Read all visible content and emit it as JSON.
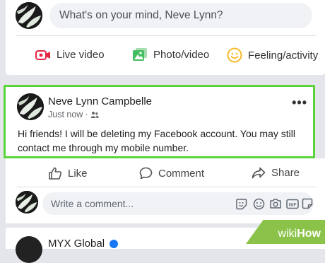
{
  "composer": {
    "placeholder": "What's on your mind, Neve Lynn?",
    "actions": [
      {
        "label": "Live video",
        "icon": "live-video-icon",
        "color": "#e42645"
      },
      {
        "label": "Photo/video",
        "icon": "photo-icon",
        "color": "#45bd62"
      },
      {
        "label": "Feeling/activity",
        "icon": "feeling-icon",
        "color": "#f7b928"
      }
    ]
  },
  "post": {
    "author": "Neve Lynn Campbelle",
    "time": "Just now",
    "separator": "·",
    "audience_icon": "friends-icon",
    "text": "Hi friends! I will be deleting my Facebook account. You may still contact me through my mobile number.",
    "highlight_color": "#5ad43a"
  },
  "reactions": {
    "like": "Like",
    "comment": "Comment",
    "share": "Share"
  },
  "comment_box": {
    "placeholder": "Write a comment..."
  },
  "next_post": {
    "name": "MYX Global"
  },
  "watermark": {
    "prefix": "wiki",
    "suffix": "How"
  }
}
